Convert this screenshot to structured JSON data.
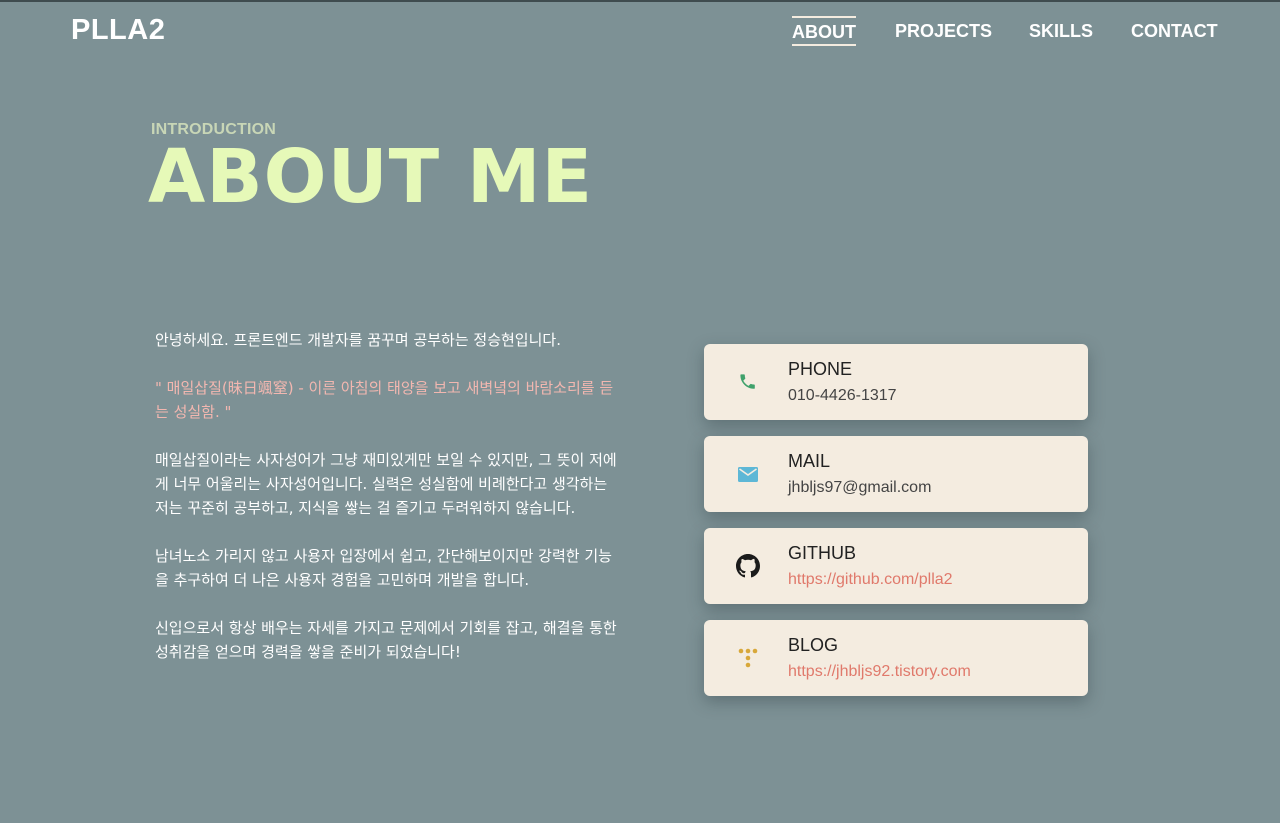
{
  "header": {
    "logo": "PLLA2",
    "nav": [
      {
        "label": "ABOUT",
        "active": true
      },
      {
        "label": "PROJECTS",
        "active": false
      },
      {
        "label": "SKILLS",
        "active": false
      },
      {
        "label": "CONTACT",
        "active": false
      }
    ]
  },
  "about": {
    "section_label": "INTRODUCTION",
    "headline": "ABOUT ME",
    "paragraphs": [
      "안녕하세요. 프론트엔드 개발자를 꿈꾸며 공부하는 정승현입니다.",
      "\" 매일삽질(昧日颯窒) - 이른 아침의 태양을 보고 새벽녘의 바람소리를 듣는 성실함. \"",
      "매일삽질이라는 사자성어가 그냥 재미있게만 보일 수 있지만, 그 뜻이 저에게 너무 어울리는 사자성어입니다. 실력은 성실함에 비례한다고 생각하는 저는 꾸준히 공부하고, 지식을 쌓는 걸 즐기고 두려워하지 않습니다.",
      "남녀노소 가리지 않고 사용자 입장에서 쉽고, 간단해보이지만 강력한 기능을 추구하여 더 나은 사용자 경험을 고민하며 개발을 합니다.",
      "신입으로서 항상 배우는 자세를 가지고 문제에서 기회를 잡고, 해결을 통한 성취감을 얻으며 경력을 쌓을 준비가 되었습니다!"
    ]
  },
  "contacts": [
    {
      "label": "PHONE",
      "value": "010-4426-1317",
      "icon": "phone-icon",
      "color": "#3fa16b"
    },
    {
      "label": "MAIL",
      "value": "jhbljs97@gmail.com",
      "icon": "mail-icon",
      "color": "#5db7d6"
    },
    {
      "label": "GITHUB",
      "value": "https://github.com/plla2",
      "icon": "github-icon",
      "color": "#1b1b1b"
    },
    {
      "label": "BLOG",
      "value": "https://jhbljs92.tistory.com",
      "icon": "tistory-icon",
      "color": "#d8a83a"
    }
  ],
  "colors": {
    "background": "#7d9195",
    "headline": "#e6f9b8",
    "section_label": "#c8d6b6",
    "quote": "#f2b7b0",
    "card": "#f4ece0",
    "link": "#e0796b"
  }
}
